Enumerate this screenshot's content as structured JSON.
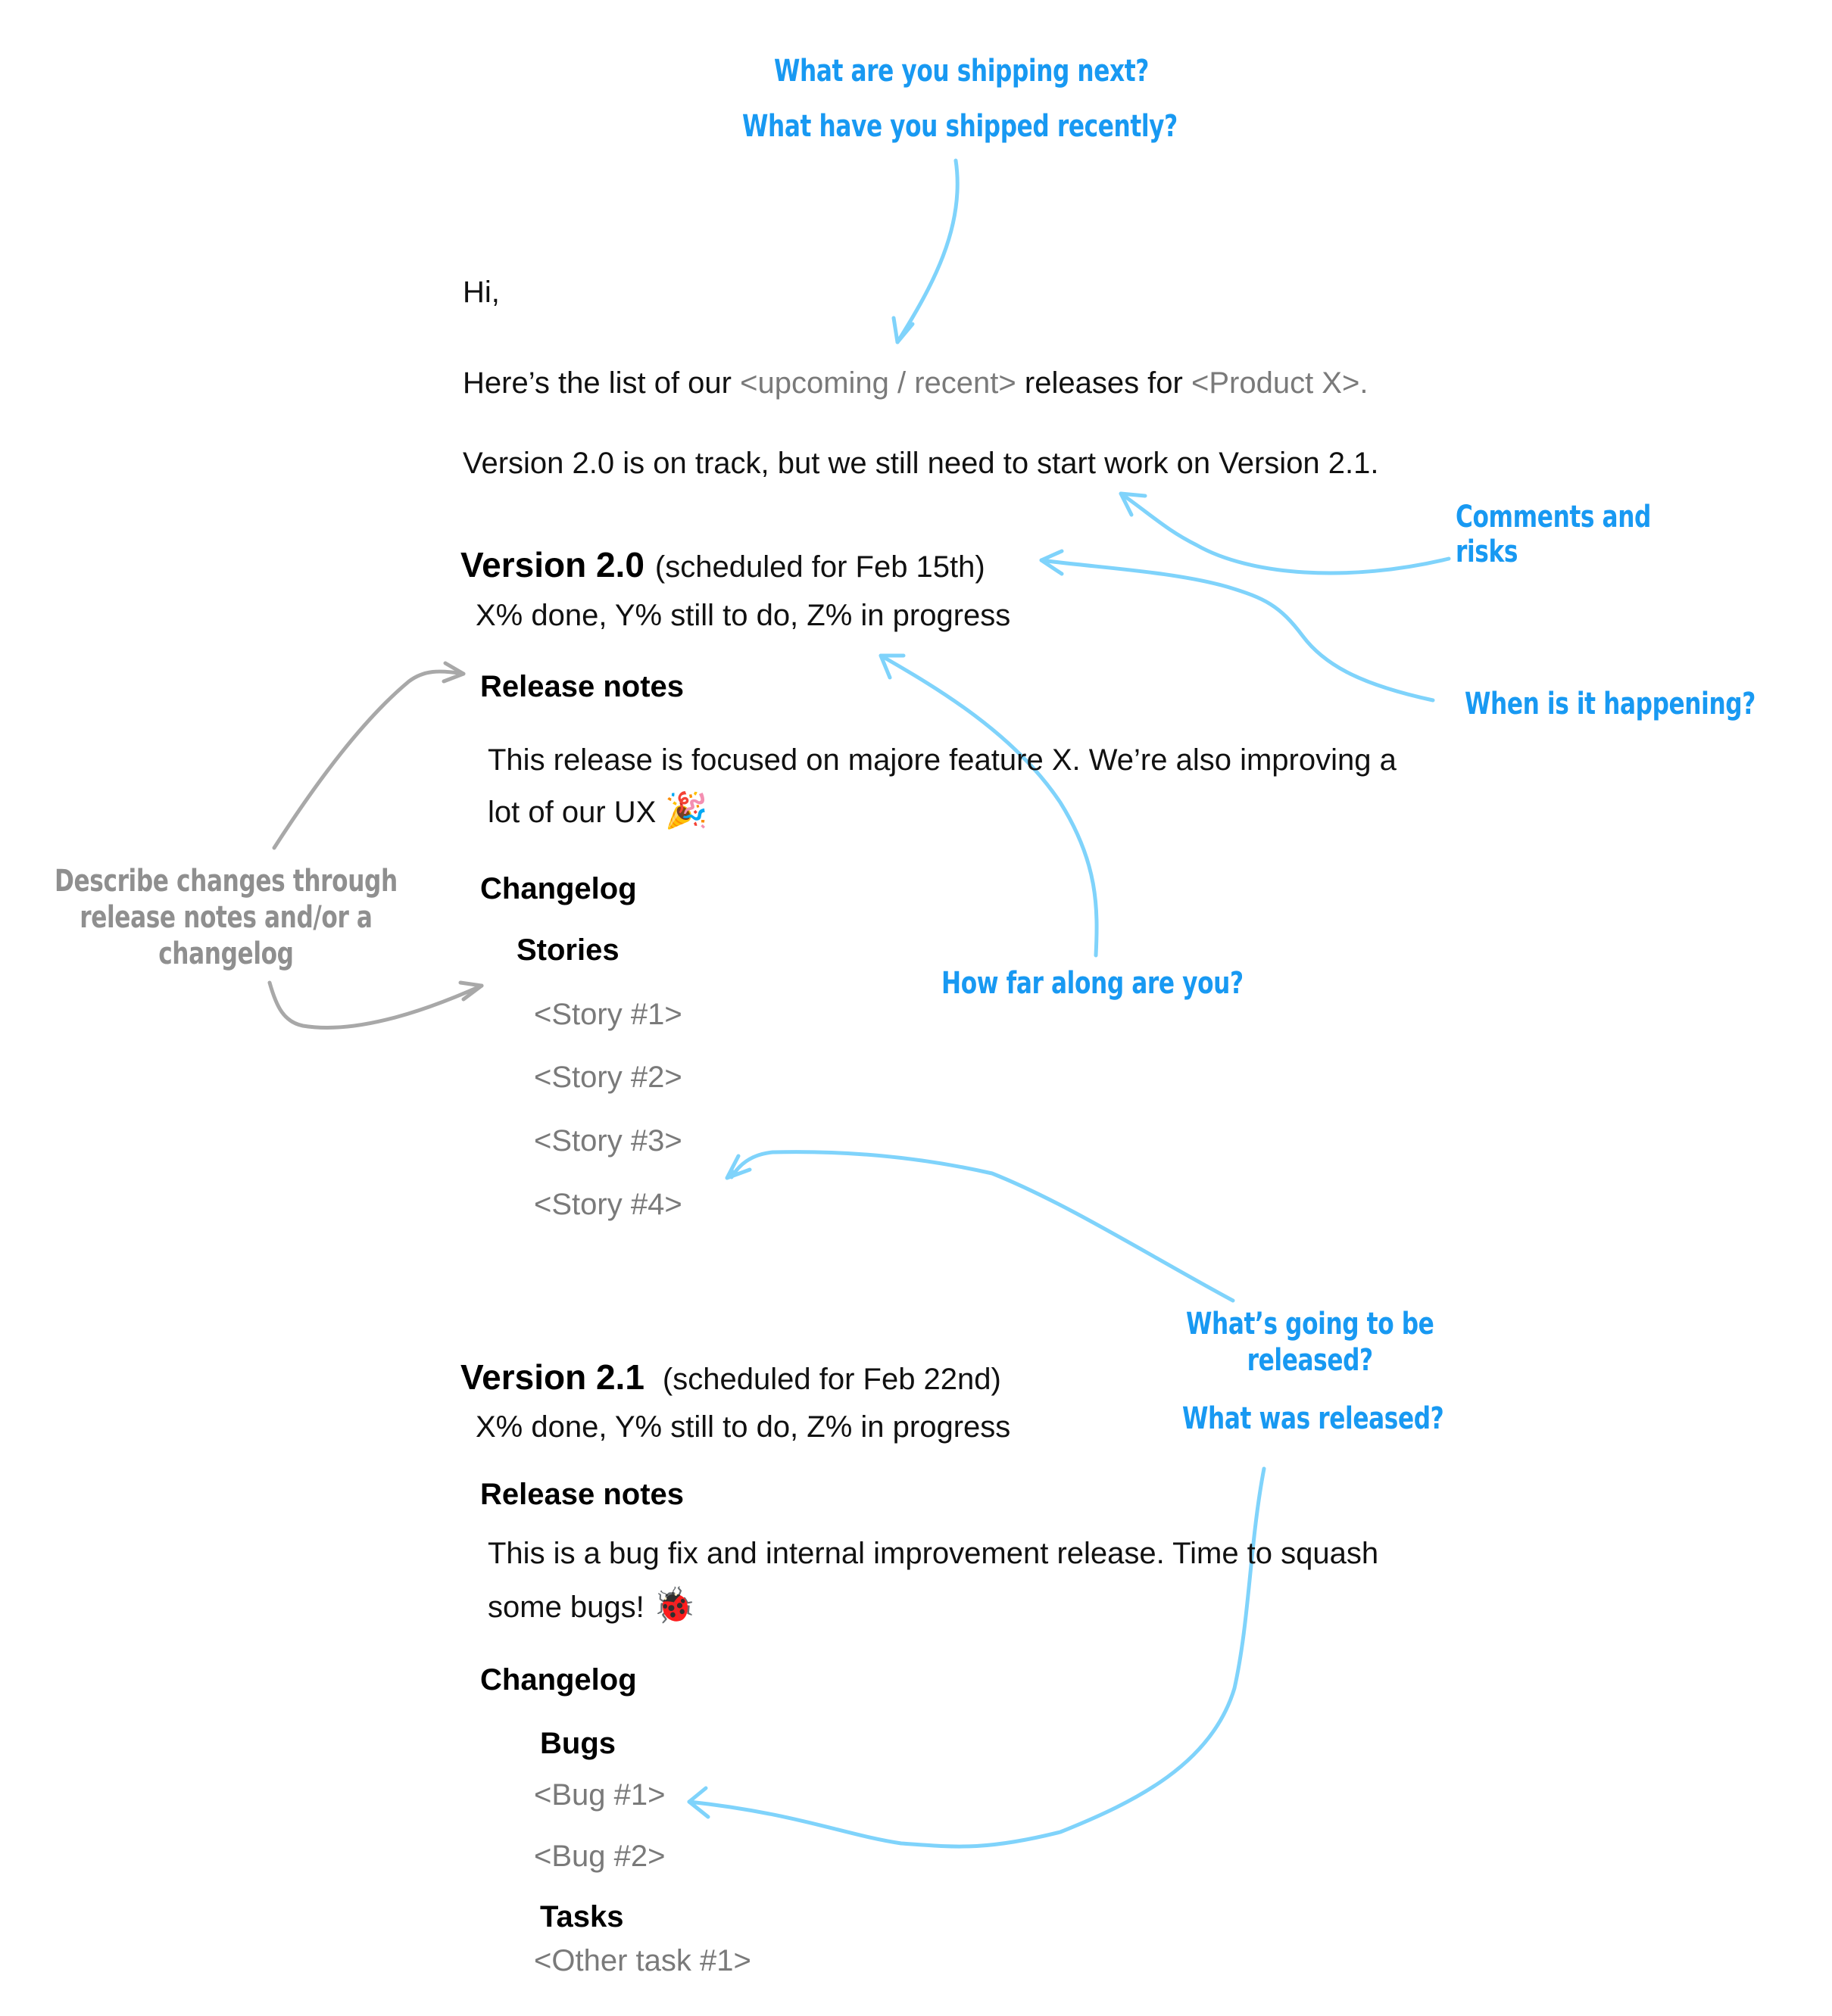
{
  "email": {
    "greeting": "Hi,",
    "intro": {
      "prefix": "Here’s the list of our ",
      "placeholder_kind": "<upcoming / recent>",
      "middle": " releases for ",
      "placeholder_product": "<Product X>",
      "suffix": "."
    },
    "summary": "Version 2.0 is on track, but we still need to start work on Version 2.1.",
    "versions": [
      {
        "title": "Version 2.0",
        "schedule": "(scheduled for Feb 15th)",
        "progress": "X% done, Y% still to do, Z% in progress",
        "release_notes_heading": "Release notes",
        "release_notes_line1": "This release is focused on majore feature X. We’re also improving a",
        "release_notes_line2": "lot of our UX",
        "release_notes_emoji": "🎉",
        "changelog_heading": "Changelog",
        "groups": [
          {
            "heading": "Stories",
            "items": [
              "<Story #1>",
              "<Story #2>",
              "<Story #3>",
              "<Story #4>"
            ]
          }
        ]
      },
      {
        "title": "Version 2.1",
        "schedule": "(scheduled for Feb 22nd)",
        "progress": "X% done, Y% still to do, Z% in progress",
        "release_notes_heading": "Release notes",
        "release_notes_line1": "This is a bug fix and internal improvement release. Time to squash",
        "release_notes_line2": "some bugs!",
        "release_notes_emoji": "🐞",
        "changelog_heading": "Changelog",
        "groups": [
          {
            "heading": "Bugs",
            "items": [
              "<Bug #1>",
              "<Bug #2>"
            ]
          },
          {
            "heading": "Tasks",
            "items": [
              "<Other task #1>"
            ]
          }
        ]
      }
    ]
  },
  "annotations": {
    "top_line1": "What are you shipping next?",
    "top_line2": "What have you shipped recently?",
    "comments_line1": "Comments and",
    "comments_line2": "risks",
    "when": "When is it happening?",
    "how_far": "How far along are you?",
    "describe_line1": "Describe changes through",
    "describe_line2": "release notes and/or a",
    "describe_line3": "changelog",
    "released_line1": "What’s going to be",
    "released_line2": "released?",
    "released_line3": "What was released?"
  },
  "colors": {
    "annotation_blue": "#1899f2",
    "arrow_blue": "#7fd3fb",
    "annotation_gray": "#8f8f8f",
    "placeholder_gray": "#7a7a7a"
  }
}
